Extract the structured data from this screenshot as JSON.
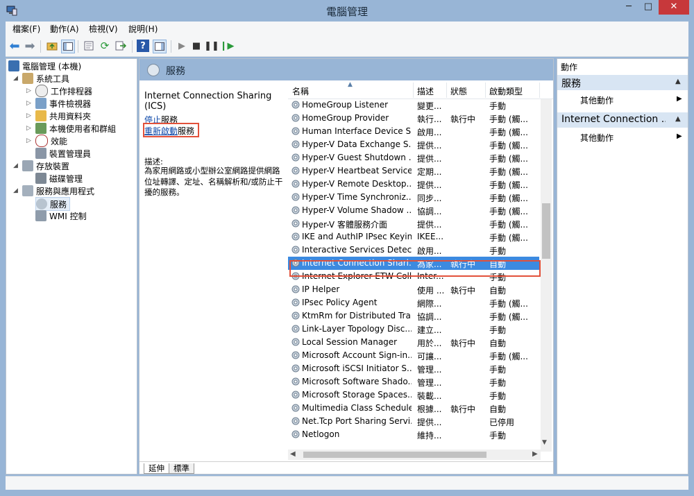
{
  "window": {
    "title": "電腦管理",
    "minimize": "─",
    "maximize": "□",
    "close": "✕"
  },
  "menu": [
    "檔案(F)",
    "動作(A)",
    "檢視(V)",
    "說明(H)"
  ],
  "tree": {
    "root": "電腦管理 (本機)",
    "system_tools": "系統工具",
    "task_scheduler": "工作排程器",
    "event_viewer": "事件檢視器",
    "shared_folders": "共用資料夾",
    "local_users": "本機使用者和群組",
    "performance": "效能",
    "device_manager": "裝置管理員",
    "storage": "存放裝置",
    "disk_management": "磁碟管理",
    "services_apps": "服務與應用程式",
    "services": "服務",
    "wmi": "WMI 控制"
  },
  "center": {
    "header": "服務",
    "service_title": "Internet Connection Sharing (ICS)",
    "stop_link": "停止",
    "stop_suffix": "服務",
    "restart_link": "重新啟動",
    "restart_suffix": "服務",
    "desc_label": "描述:",
    "desc_text": "為家用網路或小型辦公室網路提供網路位址轉譯、定址、名稱解析和/或防止干擾的服務。",
    "tab_extended": "延伸",
    "tab_standard": "標準"
  },
  "list": {
    "columns": [
      "名稱",
      "描述",
      "狀態",
      "啟動類型"
    ],
    "rows": [
      {
        "name": "HomeGroup Listener",
        "desc": "變更...",
        "status": "",
        "startup": "手動"
      },
      {
        "name": "HomeGroup Provider",
        "desc": "執行...",
        "status": "執行中",
        "startup": "手動 (觸..."
      },
      {
        "name": "Human Interface Device S...",
        "desc": "啟用...",
        "status": "",
        "startup": "手動 (觸..."
      },
      {
        "name": "Hyper-V Data Exchange S...",
        "desc": "提供...",
        "status": "",
        "startup": "手動 (觸..."
      },
      {
        "name": "Hyper-V Guest Shutdown ...",
        "desc": "提供...",
        "status": "",
        "startup": "手動 (觸..."
      },
      {
        "name": "Hyper-V Heartbeat Service",
        "desc": "定期...",
        "status": "",
        "startup": "手動 (觸..."
      },
      {
        "name": "Hyper-V Remote Desktop...",
        "desc": "提供...",
        "status": "",
        "startup": "手動 (觸..."
      },
      {
        "name": "Hyper-V Time Synchroniz...",
        "desc": "同步...",
        "status": "",
        "startup": "手動 (觸..."
      },
      {
        "name": "Hyper-V Volume Shadow ...",
        "desc": "協調...",
        "status": "",
        "startup": "手動 (觸..."
      },
      {
        "name": "Hyper-V 客體服務介面",
        "desc": "提供...",
        "status": "",
        "startup": "手動 (觸..."
      },
      {
        "name": "IKE and AuthIP IPsec Keyin...",
        "desc": "IKEE...",
        "status": "",
        "startup": "手動 (觸..."
      },
      {
        "name": "Interactive Services Detect...",
        "desc": "啟用...",
        "status": "",
        "startup": "手動"
      },
      {
        "name": "Internet Connection Shari...",
        "desc": "為家...",
        "status": "執行中",
        "startup": "自動"
      },
      {
        "name": "Internet Explorer ETW Coll...",
        "desc": "Inter...",
        "status": "",
        "startup": "手動"
      },
      {
        "name": "IP Helper",
        "desc": "使用 ...",
        "status": "執行中",
        "startup": "自動"
      },
      {
        "name": "IPsec Policy Agent",
        "desc": "網際...",
        "status": "",
        "startup": "手動 (觸..."
      },
      {
        "name": "KtmRm for Distributed Tra...",
        "desc": "協調...",
        "status": "",
        "startup": "手動 (觸..."
      },
      {
        "name": "Link-Layer Topology Disc...",
        "desc": "建立...",
        "status": "",
        "startup": "手動"
      },
      {
        "name": "Local Session Manager",
        "desc": "用於...",
        "status": "執行中",
        "startup": "自動"
      },
      {
        "name": "Microsoft Account Sign-in...",
        "desc": "可讓...",
        "status": "",
        "startup": "手動 (觸..."
      },
      {
        "name": "Microsoft iSCSI Initiator S...",
        "desc": "管理...",
        "status": "",
        "startup": "手動"
      },
      {
        "name": "Microsoft Software Shado...",
        "desc": "管理...",
        "status": "",
        "startup": "手動"
      },
      {
        "name": "Microsoft Storage Spaces...",
        "desc": "裝載...",
        "status": "",
        "startup": "手動"
      },
      {
        "name": "Multimedia Class Scheduler",
        "desc": "根據...",
        "status": "執行中",
        "startup": "自動"
      },
      {
        "name": "Net.Tcp Port Sharing Servi...",
        "desc": "提供...",
        "status": "",
        "startup": "已停用"
      },
      {
        "name": "Netlogon",
        "desc": "維持...",
        "status": "",
        "startup": "手動"
      }
    ],
    "selected_index": 12
  },
  "actions": {
    "header": "動作",
    "group1_title": "服務",
    "group1_item": "其他動作",
    "group2_title": "Internet Connection ...",
    "group2_item": "其他動作"
  },
  "colors": {
    "selection": "#3c8ae0",
    "highlight_box": "#e2513a",
    "header_bg": "#98b5d6"
  }
}
